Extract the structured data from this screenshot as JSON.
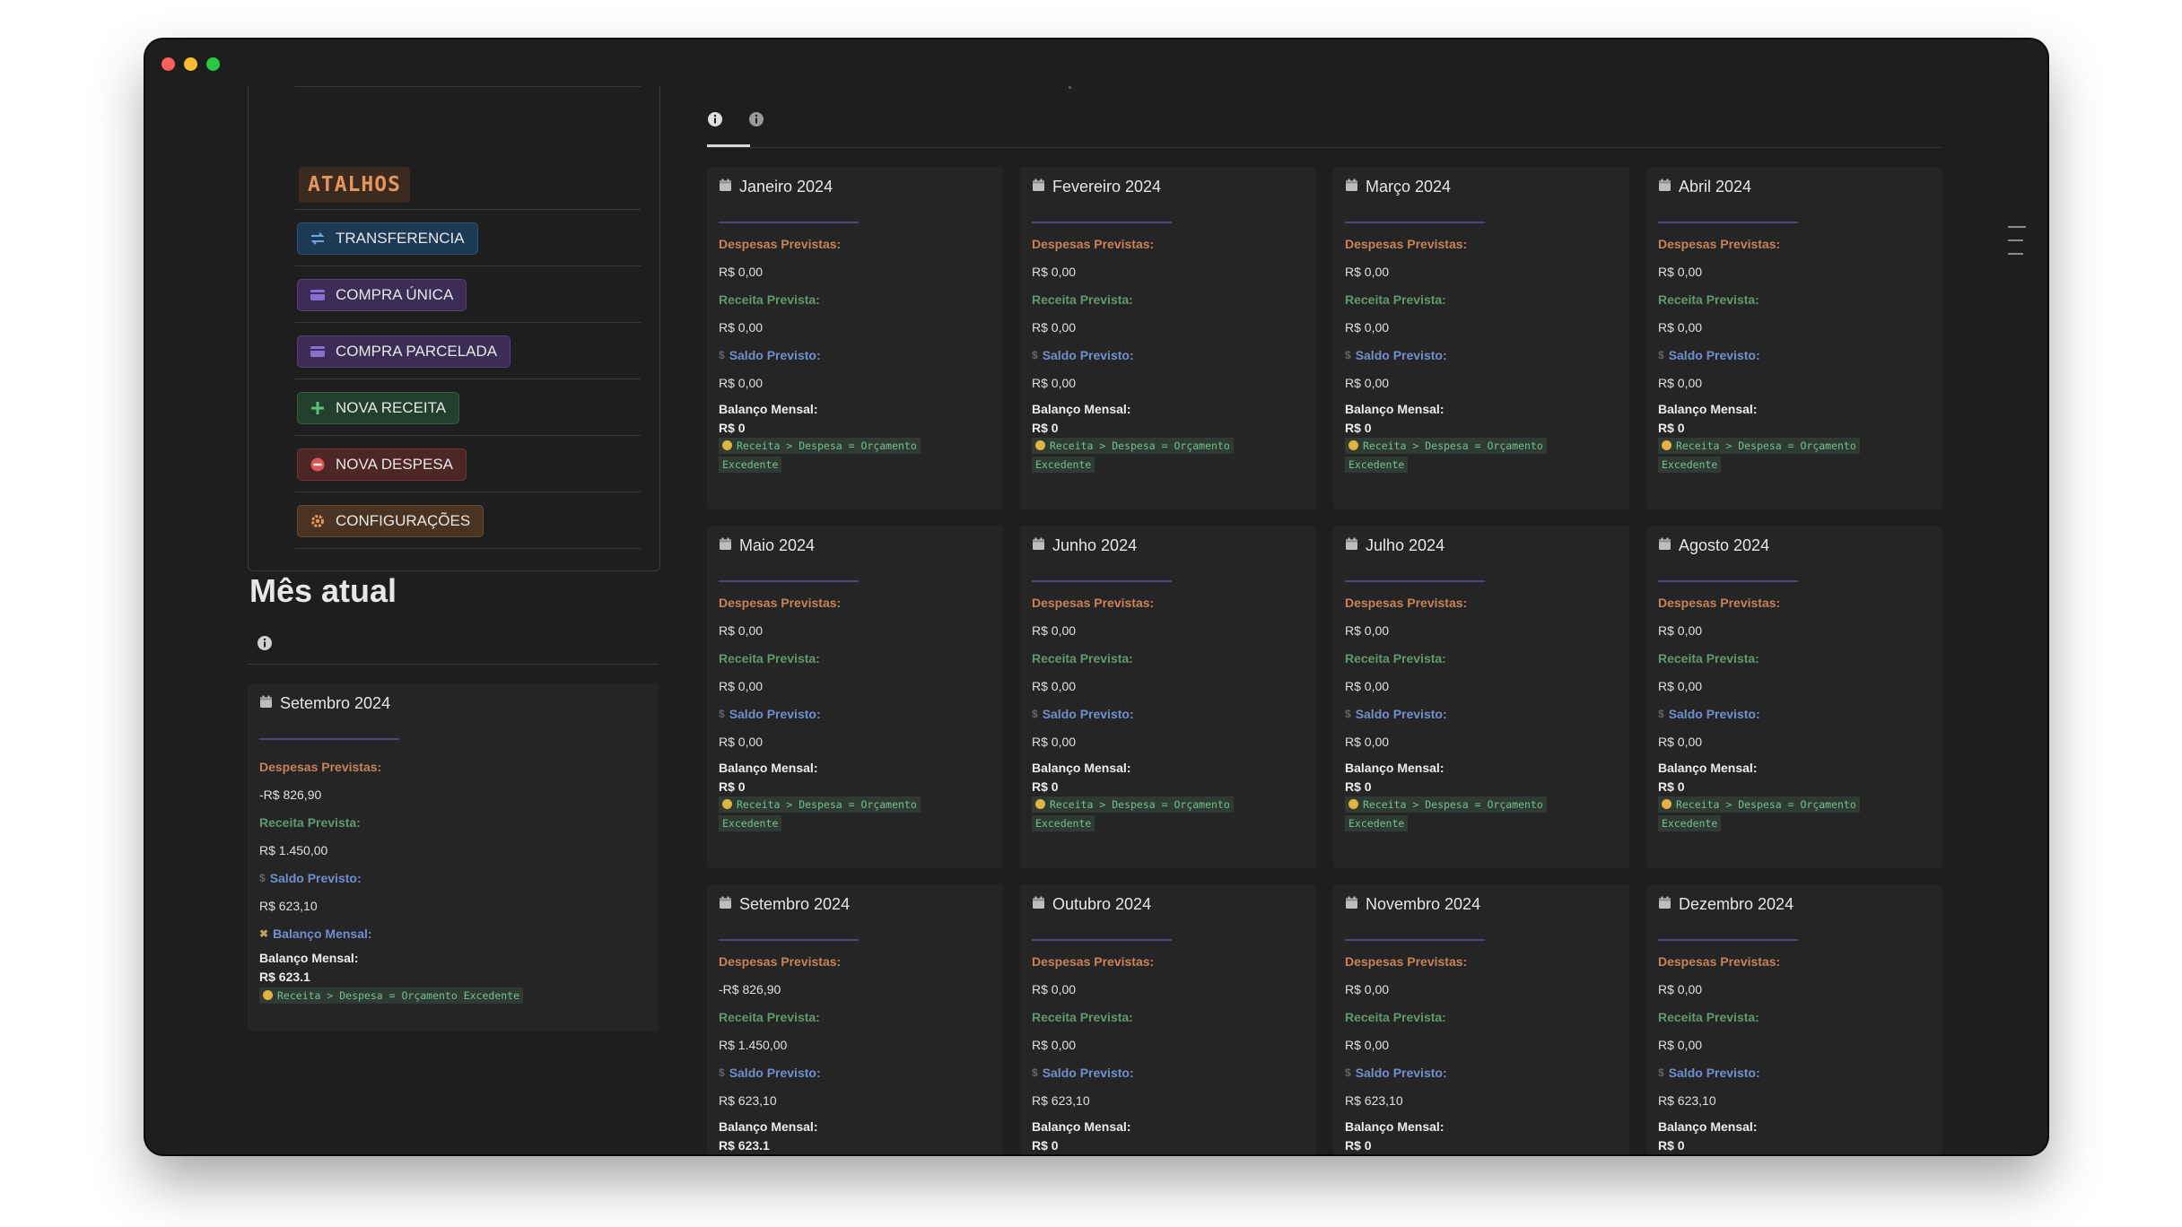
{
  "shortcuts": {
    "header": "ATALHOS",
    "buttons": [
      {
        "label": "TRANSFERENCIA",
        "icon": "transfer-icon"
      },
      {
        "label": "COMPRA ÚNICA",
        "icon": "card-icon"
      },
      {
        "label": "COMPRA PARCELADA",
        "icon": "card-icon"
      },
      {
        "label": "NOVA RECEITA",
        "icon": "plus-icon"
      },
      {
        "label": "NOVA DESPESA",
        "icon": "minus-icon"
      },
      {
        "label": "CONFIGURAÇÕES",
        "icon": "gear-icon"
      }
    ]
  },
  "current": {
    "heading": "Mês atual",
    "card": {
      "title": "Setembro 2024",
      "despesas_label": "Despesas Previstas:",
      "despesas": "-R$ 826,90",
      "receita_label": "Receita Prevista:",
      "receita": "R$ 1.450,00",
      "saldo_label": "Saldo Previsto:",
      "saldo": "R$ 623,10",
      "balanco_link": "Balanço Mensal:",
      "balanco_label": "Balanço Mensal:",
      "balanco": "R$ 623.1",
      "status": "Receita > Despesa = Orçamento Excedente"
    }
  },
  "months": [
    {
      "title": "Janeiro 2024",
      "despesas": "R$ 0,00",
      "receita": "R$ 0,00",
      "saldo": "R$ 0,00",
      "balanco": "R$ 0"
    },
    {
      "title": "Fevereiro 2024",
      "despesas": "R$ 0,00",
      "receita": "R$ 0,00",
      "saldo": "R$ 0,00",
      "balanco": "R$ 0"
    },
    {
      "title": "Março 2024",
      "despesas": "R$ 0,00",
      "receita": "R$ 0,00",
      "saldo": "R$ 0,00",
      "balanco": "R$ 0"
    },
    {
      "title": "Abril 2024",
      "despesas": "R$ 0,00",
      "receita": "R$ 0,00",
      "saldo": "R$ 0,00",
      "balanco": "R$ 0"
    },
    {
      "title": "Maio 2024",
      "despesas": "R$ 0,00",
      "receita": "R$ 0,00",
      "saldo": "R$ 0,00",
      "balanco": "R$ 0"
    },
    {
      "title": "Junho 2024",
      "despesas": "R$ 0,00",
      "receita": "R$ 0,00",
      "saldo": "R$ 0,00",
      "balanco": "R$ 0"
    },
    {
      "title": "Julho 2024",
      "despesas": "R$ 0,00",
      "receita": "R$ 0,00",
      "saldo": "R$ 0,00",
      "balanco": "R$ 0"
    },
    {
      "title": "Agosto 2024",
      "despesas": "R$ 0,00",
      "receita": "R$ 0,00",
      "saldo": "R$ 0,00",
      "balanco": "R$ 0"
    },
    {
      "title": "Setembro 2024",
      "despesas": "-R$ 826,90",
      "receita": "R$ 1.450,00",
      "saldo": "R$ 623,10",
      "balanco": "R$ 623.1"
    },
    {
      "title": "Outubro 2024",
      "despesas": "R$ 0,00",
      "receita": "R$ 0,00",
      "saldo": "R$ 623,10",
      "balanco": "R$ 0"
    },
    {
      "title": "Novembro 2024",
      "despesas": "R$ 0,00",
      "receita": "R$ 0,00",
      "saldo": "R$ 623,10",
      "balanco": "R$ 0"
    },
    {
      "title": "Dezembro 2024",
      "despesas": "R$ 0,00",
      "receita": "R$ 0,00",
      "saldo": "R$ 623,10",
      "balanco": "R$ 0"
    }
  ],
  "labels": {
    "despesas": "Despesas Previstas:",
    "receita": "Receita Prevista:",
    "saldo": "Saldo Previsto:",
    "balanco": "Balanço Mensal:",
    "status_line1": "Receita > Despesa = Orçamento",
    "status_line2": "Excedente"
  },
  "colors": {
    "window_bg": "#1e1e1e",
    "card_bg": "#252525",
    "despesas": "#c8825a",
    "receita": "#5f9a6e",
    "saldo": "#6f8fcf",
    "status": "#73c08e",
    "divider": "#4d4580"
  }
}
